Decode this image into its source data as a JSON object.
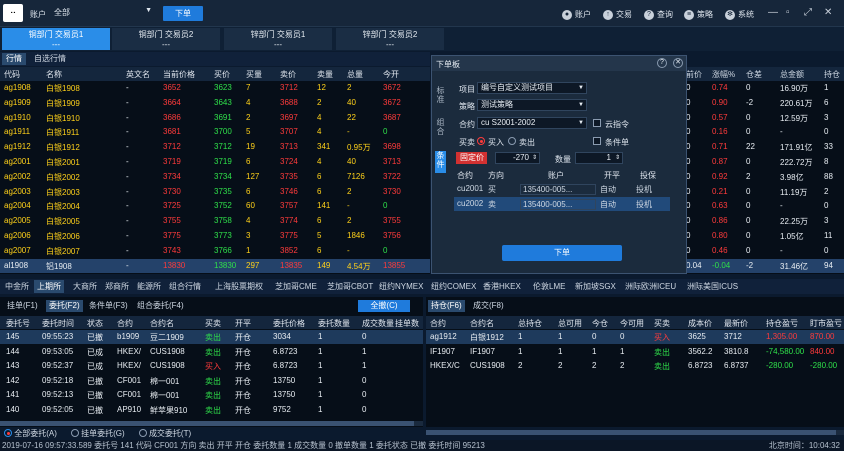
{
  "topbar": {
    "logo": "ᐧᐧ",
    "account_label": "账户",
    "account_value": "全部",
    "order_button": "下单",
    "menu": [
      {
        "icon": "user-icon",
        "glyph": "●",
        "label": "账户"
      },
      {
        "icon": "trade-icon",
        "glyph": "↑",
        "label": "交易"
      },
      {
        "icon": "query-icon",
        "glyph": "?",
        "label": "查询"
      },
      {
        "icon": "strategy-icon",
        "glyph": "≡",
        "label": "策略"
      },
      {
        "icon": "gear-icon",
        "glyph": "✻",
        "label": "系统"
      }
    ],
    "window_controls": [
      "—",
      "▫",
      "⤢",
      "✕"
    ]
  },
  "trader_tabs": [
    {
      "label": "铜部门 交易员1",
      "sub": "---",
      "active": true
    },
    {
      "label": "铜部门 交易员2",
      "sub": "---"
    },
    {
      "label": "锌部门 交易员1",
      "sub": "---"
    },
    {
      "label": "锌部门 交易员2",
      "sub": "---"
    }
  ],
  "quote_tabs": [
    "行情",
    "自选行情"
  ],
  "quote_headers": [
    "代码",
    "名称",
    "英文名",
    "当前价格",
    "买价",
    "买量",
    "卖价",
    "卖量",
    "总量",
    "今开"
  ],
  "quotes": [
    [
      "ag1908",
      "白银1908",
      "-",
      "3652",
      "3623",
      "7",
      "3712",
      "12",
      "2",
      "3672"
    ],
    [
      "ag1909",
      "白银1909",
      "-",
      "3664",
      "3643",
      "4",
      "3688",
      "2",
      "40",
      "3672"
    ],
    [
      "ag1910",
      "白银1910",
      "-",
      "3686",
      "3691",
      "2",
      "3697",
      "4",
      "22",
      "3687"
    ],
    [
      "ag1911",
      "白银1911",
      "-",
      "3681",
      "3700",
      "5",
      "3707",
      "4",
      "-",
      "0"
    ],
    [
      "ag1912",
      "白银1912",
      "-",
      "3712",
      "3712",
      "19",
      "3713",
      "341",
      "0.95万",
      "3698"
    ],
    [
      "ag2001",
      "白银2001",
      "-",
      "3719",
      "3719",
      "6",
      "3724",
      "4",
      "40",
      "3713"
    ],
    [
      "ag2002",
      "白银2002",
      "-",
      "3734",
      "3734",
      "127",
      "3735",
      "6",
      "7126",
      "3722"
    ],
    [
      "ag2003",
      "白银2003",
      "-",
      "3730",
      "3735",
      "6",
      "3746",
      "6",
      "2",
      "3730"
    ],
    [
      "ag2004",
      "白银2004",
      "-",
      "3725",
      "3752",
      "60",
      "3757",
      "141",
      "-",
      "0"
    ],
    [
      "ag2005",
      "白银2005",
      "-",
      "3755",
      "3758",
      "4",
      "3774",
      "6",
      "2",
      "3755"
    ],
    [
      "ag2006",
      "白银2006",
      "-",
      "3775",
      "3773",
      "3",
      "3775",
      "5",
      "1846",
      "3756"
    ],
    [
      "ag2007",
      "白银2007",
      "-",
      "3743",
      "3766",
      "1",
      "3852",
      "6",
      "-",
      "0"
    ],
    [
      "al1908",
      "铝1908",
      "-",
      "13830",
      "13830",
      "297",
      "13835",
      "149",
      "4.54万",
      "13855"
    ]
  ],
  "right_headers": [
    "前价",
    "涨幅%",
    "仓差",
    "总金额",
    "持仓"
  ],
  "right_quotes": [
    [
      "0",
      "0.74",
      "0",
      "16.90万",
      "1"
    ],
    [
      "0",
      "0.90",
      "-2",
      "220.61万",
      "6"
    ],
    [
      "0",
      "0.57",
      "0",
      "12.59万",
      "3"
    ],
    [
      "0",
      "0.16",
      "0",
      "-",
      "0"
    ],
    [
      "0",
      "0.71",
      "22",
      "171.91亿",
      "33"
    ],
    [
      "0",
      "0.87",
      "0",
      "222.72万",
      "8"
    ],
    [
      "0",
      "0.92",
      "2",
      "3.98亿",
      "88"
    ],
    [
      "0",
      "0.21",
      "0",
      "11.19万",
      "2"
    ],
    [
      "0",
      "0.63",
      "0",
      "-",
      "0"
    ],
    [
      "0",
      "0.86",
      "0",
      "22.25万",
      "3"
    ],
    [
      "0",
      "0.80",
      "0",
      "1.05亿",
      "11"
    ],
    [
      "0",
      "0.46",
      "0",
      "-",
      "0"
    ],
    [
      "0.04",
      "-0.04",
      "-2",
      "31.46亿",
      "94"
    ]
  ],
  "dialog": {
    "title": "下单板",
    "help": "?",
    "close": "✕",
    "vtabs": [
      "标准",
      "组合",
      "条件"
    ],
    "project_label": "项目",
    "project_value": "编号自定义测试项目",
    "strategy_label": "策略",
    "strategy_value": "测试策略",
    "contract_label": "合约",
    "contract_value": "cu S2001-2002",
    "cloud_label": "云指令",
    "direction_label": "买卖",
    "buy": "买入",
    "sell": "卖出",
    "conditional_label": "条件单",
    "price_type": "固定价",
    "price_value": "-270",
    "qty_label": "数量",
    "qty_value": "1",
    "leg_headers": [
      "合约",
      "方向",
      "账户",
      "开平",
      "投保"
    ],
    "legs": [
      [
        "cu2001",
        "买",
        "135400-005...",
        "自动",
        "投机"
      ],
      [
        "cu2002",
        "卖",
        "135400-005...",
        "自动",
        "投机"
      ]
    ],
    "submit": "下单"
  },
  "exchange_tabs": [
    "中金所",
    "上期所",
    "大商所",
    "郑商所",
    "能源所",
    "组合行情",
    "上海股票期权",
    "芝加哥CME",
    "芝加哥CBOT",
    "纽约NYMEX",
    "纽约COMEX",
    "香港HKEX",
    "伦敦LME",
    "新加坡SGX",
    "洲际欧洲ICEU",
    "洲际美国ICUS"
  ],
  "orders_panel": {
    "tabs": [
      "挂单(F1)",
      "委托(F2)",
      "条件单(F3)",
      "组合委托(F4)"
    ],
    "all_button": "全撤(C)",
    "headers": [
      "委托号",
      "委托时间",
      "状态",
      "合约",
      "合约名",
      "买卖",
      "开平",
      "委托价格",
      "委托数量",
      "成交数量",
      "挂单数"
    ],
    "rows": [
      [
        "145",
        "09:55:23",
        "已撤",
        "b1909",
        "豆二1909",
        "卖出",
        "开仓",
        "3034",
        "1",
        "0"
      ],
      [
        "144",
        "09:53:05",
        "已成",
        "HKEX/",
        "CUS1908",
        "卖出",
        "开仓",
        "6.8723",
        "1",
        "1"
      ],
      [
        "143",
        "09:52:37",
        "已成",
        "HKEX/",
        "CUS1908",
        "买入",
        "开仓",
        "6.8723",
        "1",
        "1"
      ],
      [
        "142",
        "09:52:18",
        "已撤",
        "CF001",
        "棉一001",
        "卖出",
        "开仓",
        "13750",
        "1",
        "0"
      ],
      [
        "141",
        "09:52:13",
        "已撤",
        "CF001",
        "棉一001",
        "卖出",
        "开仓",
        "13750",
        "1",
        "0"
      ],
      [
        "140",
        "09:52:05",
        "已撤",
        "AP910",
        "鲜苹果910",
        "卖出",
        "开仓",
        "9752",
        "1",
        "0"
      ]
    ],
    "filters": [
      "全部委托(A)",
      "挂单委托(G)",
      "成交委托(T)"
    ]
  },
  "positions_panel": {
    "tabs": [
      "持仓(F6)",
      "成交(F8)"
    ],
    "headers": [
      "合约",
      "合约名",
      "总持仓",
      "总可用",
      "今仓",
      "今可用",
      "买卖",
      "成本价",
      "最新价",
      "持仓盈亏",
      "盯市盈亏"
    ],
    "rows": [
      [
        "ag1912",
        "白银1912",
        "1",
        "1",
        "0",
        "0",
        "买入",
        "3625",
        "3712",
        "1,305.00",
        "870.00"
      ],
      [
        "IF1907",
        "IF1907",
        "1",
        "1",
        "1",
        "1",
        "卖出",
        "3562.2",
        "3810.8",
        "-74,580.00",
        "840.00"
      ],
      [
        "HKEX/C",
        "CUS1908",
        "2",
        "2",
        "2",
        "2",
        "卖出",
        "6.8723",
        "6.8737",
        "-280.00",
        "-280.00"
      ]
    ]
  },
  "statusbar": {
    "text": "2019-07-16 09:57:33.589 委托号 141 代码 CF001 方向 卖出 开平 开仓 委托数量 1 成交数量 0 撤单数量 1 委托状态 已撤 委托时间 95213",
    "time_label": "北京时间：10:04:32"
  }
}
